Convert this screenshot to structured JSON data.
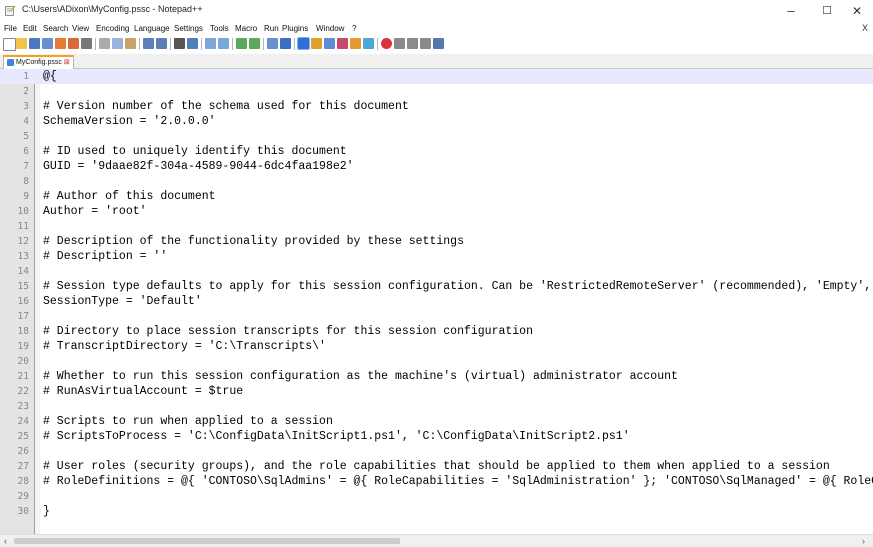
{
  "window": {
    "title": "C:\\Users\\ADixon\\MyConfig.pssc - Notepad++"
  },
  "window_controls": {
    "minimize": "–",
    "maximize": "☐",
    "close": "✕"
  },
  "menu": {
    "items": [
      "File",
      "Edit",
      "Search",
      "View",
      "Encoding",
      "Language",
      "Settings",
      "Tools",
      "Macro",
      "Run",
      "Plugins",
      "Window",
      "?"
    ],
    "close_glyph": "X"
  },
  "toolbar": {
    "icons": [
      "new-file-icon",
      "open-file-icon",
      "save-icon",
      "save-all-icon",
      "close-icon",
      "close-all-icon",
      "print-icon",
      "cut-icon",
      "copy-icon",
      "paste-icon",
      "undo-icon",
      "redo-icon",
      "find-icon",
      "replace-icon",
      "zoom-in-icon",
      "zoom-out-icon",
      "sync-vertical-icon",
      "sync-horizontal-icon",
      "word-wrap-icon",
      "show-all-chars-icon",
      "indent-guide-icon",
      "function-list-icon",
      "doc-map-icon",
      "folder-as-workspace-icon",
      "monitor-icon",
      "record-macro-icon",
      "stop-macro-icon",
      "play-macro-icon",
      "run-macro-icon",
      "save-macro-icon"
    ]
  },
  "tab": {
    "label": "MyConfig.pssc",
    "close": "⊠"
  },
  "editor": {
    "active_line": 1,
    "lines": [
      {
        "n": "1",
        "text": "@{"
      },
      {
        "n": "2",
        "text": ""
      },
      {
        "n": "3",
        "text": "# Version number of the schema used for this document"
      },
      {
        "n": "4",
        "text": "SchemaVersion = '2.0.0.0'"
      },
      {
        "n": "5",
        "text": ""
      },
      {
        "n": "6",
        "text": "# ID used to uniquely identify this document"
      },
      {
        "n": "7",
        "text": "GUID = '9daae82f-304a-4589-9044-6dc4faa198e2'"
      },
      {
        "n": "8",
        "text": ""
      },
      {
        "n": "9",
        "text": "# Author of this document"
      },
      {
        "n": "10",
        "text": "Author = 'root'"
      },
      {
        "n": "11",
        "text": ""
      },
      {
        "n": "12",
        "text": "# Description of the functionality provided by these settings"
      },
      {
        "n": "13",
        "text": "# Description = ''"
      },
      {
        "n": "14",
        "text": ""
      },
      {
        "n": "15",
        "text": "# Session type defaults to apply for this session configuration. Can be 'RestrictedRemoteServer' (recommended), 'Empty', or 'Default'"
      },
      {
        "n": "16",
        "text": "SessionType = 'Default'"
      },
      {
        "n": "17",
        "text": ""
      },
      {
        "n": "18",
        "text": "# Directory to place session transcripts for this session configuration"
      },
      {
        "n": "19",
        "text": "# TranscriptDirectory = 'C:\\Transcripts\\'"
      },
      {
        "n": "20",
        "text": ""
      },
      {
        "n": "21",
        "text": "# Whether to run this session configuration as the machine's (virtual) administrator account"
      },
      {
        "n": "22",
        "text": "# RunAsVirtualAccount = $true"
      },
      {
        "n": "23",
        "text": ""
      },
      {
        "n": "24",
        "text": "# Scripts to run when applied to a session"
      },
      {
        "n": "25",
        "text": "# ScriptsToProcess = 'C:\\ConfigData\\InitScript1.ps1', 'C:\\ConfigData\\InitScript2.ps1'"
      },
      {
        "n": "26",
        "text": ""
      },
      {
        "n": "27",
        "text": "# User roles (security groups), and the role capabilities that should be applied to them when applied to a session"
      },
      {
        "n": "28",
        "text": "# RoleDefinitions = @{ 'CONTOSO\\SqlAdmins' = @{ RoleCapabilities = 'SqlAdministration' }; 'CONTOSO\\SqlManaged' = @{ RoleCapabilityFiles = 'C:\\RoleCapability\\SqlManaged.psrc' } }"
      },
      {
        "n": "29",
        "text": ""
      },
      {
        "n": "30",
        "text": "}"
      }
    ]
  },
  "scrollbar": {
    "left_arrow": "‹",
    "right_arrow": "›"
  },
  "colors": {
    "accent_tab": "#f7a11c",
    "active_line": "#e8e8ff",
    "gutter": "#e4e4e4"
  }
}
